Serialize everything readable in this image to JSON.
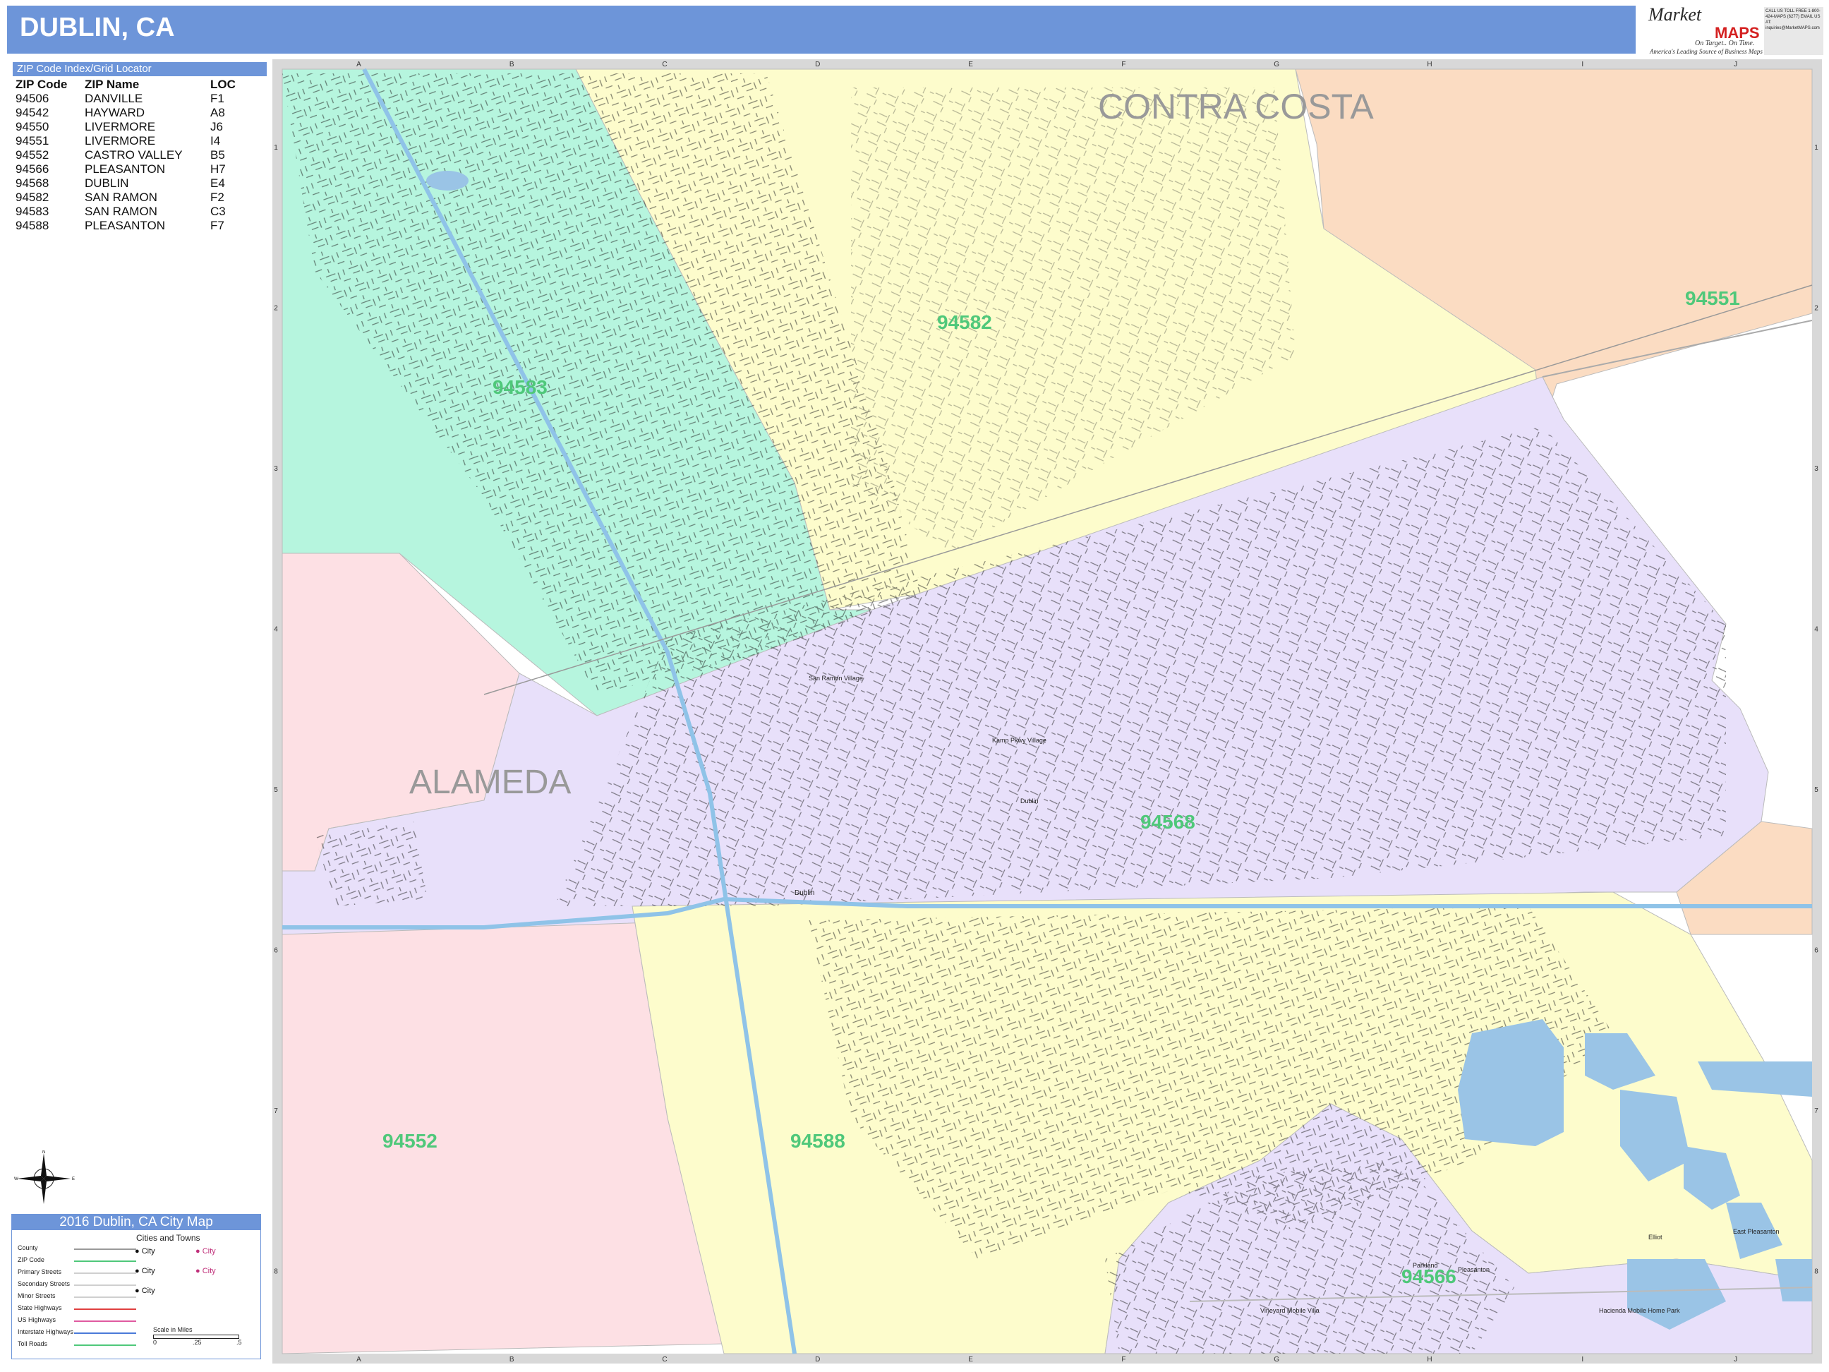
{
  "header": {
    "title": "DUBLIN, CA"
  },
  "logo": {
    "brand": "Market",
    "brand_accent": "MAPS",
    "tagline": "On Target.. On Time.",
    "subtitle": "America's Leading Source of Business Maps",
    "contact": "CALL US TOLL FREE 1-800-424-MAPS (6277) EMAIL US AT: inquiries@MarketMAPS.com"
  },
  "zip_index": {
    "heading": "ZIP Code Index/Grid Locator",
    "columns": [
      "ZIP Code",
      "ZIP Name",
      "LOC"
    ],
    "rows": [
      [
        "94506",
        "DANVILLE",
        "F1"
      ],
      [
        "94542",
        "HAYWARD",
        "A8"
      ],
      [
        "94550",
        "LIVERMORE",
        "J6"
      ],
      [
        "94551",
        "LIVERMORE",
        "I4"
      ],
      [
        "94552",
        "CASTRO VALLEY",
        "B5"
      ],
      [
        "94566",
        "PLEASANTON",
        "H7"
      ],
      [
        "94568",
        "DUBLIN",
        "E4"
      ],
      [
        "94582",
        "SAN RAMON",
        "F2"
      ],
      [
        "94583",
        "SAN RAMON",
        "C3"
      ],
      [
        "94588",
        "PLEASANTON",
        "F7"
      ]
    ]
  },
  "map": {
    "grid_cols": [
      "A",
      "B",
      "C",
      "D",
      "E",
      "F",
      "G",
      "H",
      "I",
      "J"
    ],
    "grid_rows": [
      "1",
      "2",
      "3",
      "4",
      "5",
      "6",
      "7",
      "8"
    ],
    "county_labels": [
      "CONTRA COSTA",
      "ALAMEDA"
    ],
    "zip_labels": [
      "94582",
      "94551",
      "94583",
      "94568",
      "94552",
      "94588",
      "94566"
    ],
    "place_labels": [
      "San Ramon Village",
      "Kamp Pkwy Village",
      "Dublin",
      "Dublin",
      "Parkland",
      "Pleasanton",
      "Vineyard Mobile Villa",
      "Hacienda Mobile Home Park",
      "Elliot",
      "East Pleasanton"
    ],
    "colors": {
      "zip_94583": "#b6f5de",
      "zip_94582_94588": "#fdfccc",
      "zip_94551": "#fbdcc2",
      "zip_94568_94566": "#e8e0fa",
      "zip_94552": "#fde0e4",
      "water": "#9ac4e6",
      "highway": "#8fc3e8",
      "zip_label": "#4fc87a",
      "county_label": "#999999"
    }
  },
  "legend": {
    "title": "2016 Dublin, CA City Map",
    "items": [
      "County",
      "ZIP Code",
      "Primary Streets",
      "Secondary Streets",
      "Minor Streets",
      "State Highways",
      "US Highways",
      "Interstate Highways",
      "Toll Roads"
    ],
    "cities_heading": "Cities and Towns",
    "city_word": "City",
    "scale_title": "Scale in Miles",
    "scale_ticks": [
      "0",
      ".25",
      ".5"
    ]
  }
}
